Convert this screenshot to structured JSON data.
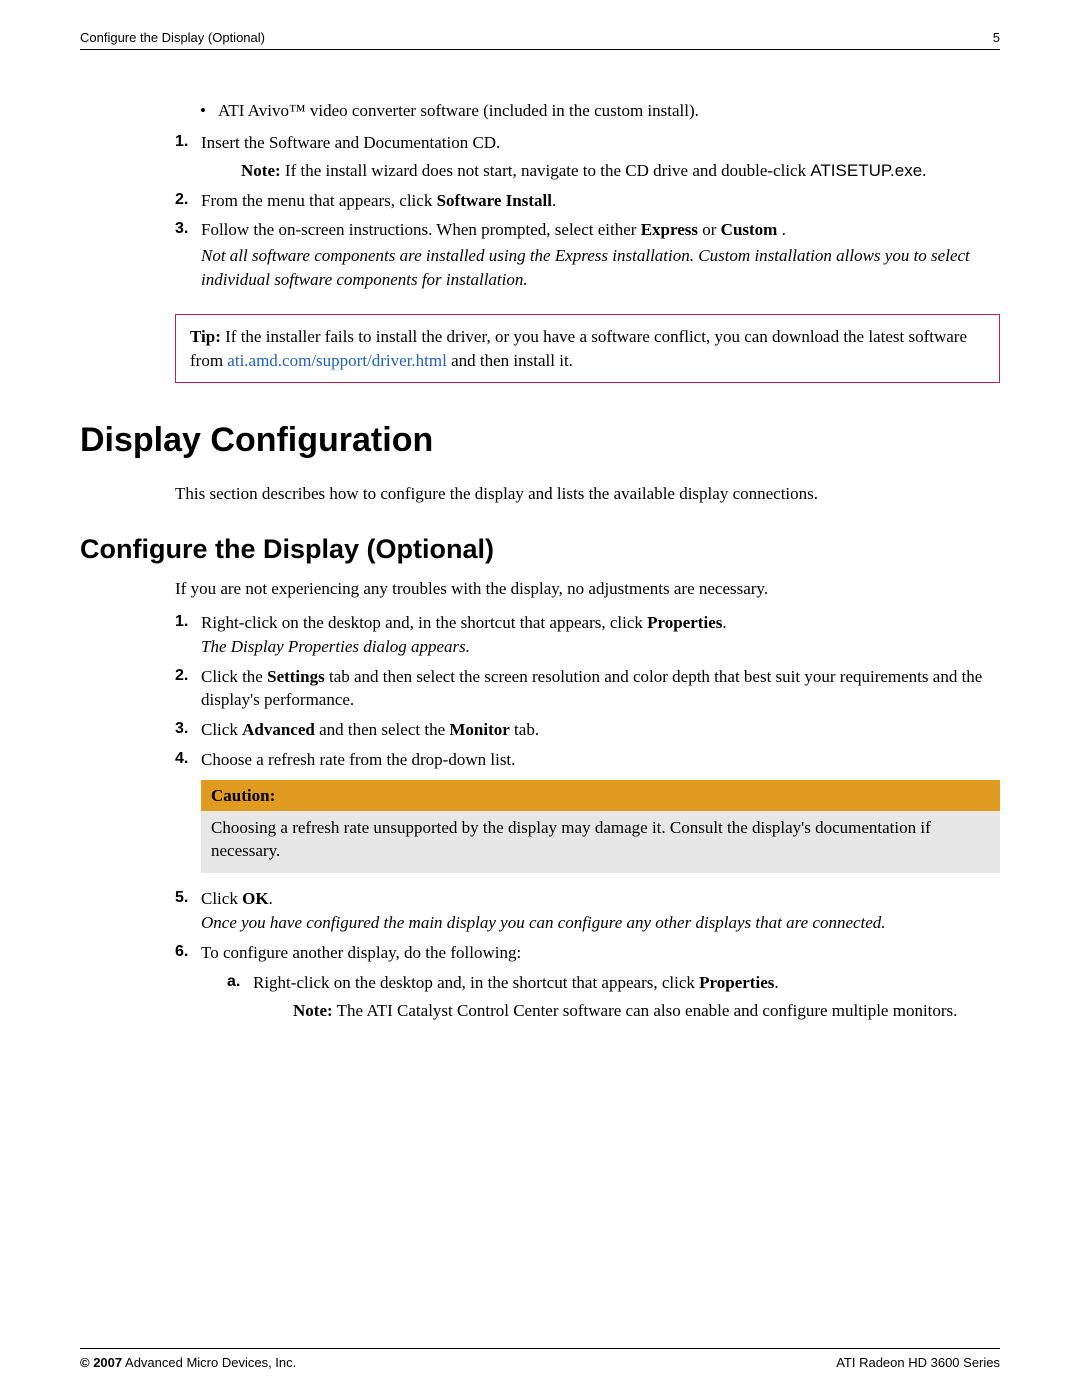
{
  "header": {
    "left": "Configure the Display (Optional)",
    "right": "5"
  },
  "bullet": {
    "text": "ATI Avivo™ video converter software (included in the custom install)."
  },
  "install_steps": {
    "s1": "Insert the Software and Documentation CD.",
    "s1_note_label": "Note:",
    "s1_note": "If the install wizard does not start, navigate to the CD drive and double-click ",
    "s1_note_file": "ATISETUP.exe",
    "s1_note_tail": ".",
    "s2_a": "From the menu that appears, click ",
    "s2_b": "Software Install",
    "s2_c": ".",
    "s3_a": "Follow the on-screen instructions. When prompted, select either ",
    "s3_b": "Express",
    "s3_c": " or ",
    "s3_d": "Custom",
    "s3_e": " .",
    "s3_note": "Not all software components are installed using the Express installation. Custom installation allows you to select individual software components for installation."
  },
  "tip": {
    "label": "Tip:",
    "t1": "If the installer fails to install the driver, or you have a software conflict, you can download the latest software from ",
    "link": "ati.amd.com/support/driver.html",
    "t2": " and then install it."
  },
  "h1": "Display Configuration",
  "h1_para": "This section describes how to configure the display and lists the available display connections.",
  "h2": "Configure the Display (Optional)",
  "h2_para": "If you are not experiencing any troubles with the display, no adjustments are necessary.",
  "cfg": {
    "s1_a": "Right-click on the desktop and, in the shortcut that appears, click ",
    "s1_b": "Properties",
    "s1_c": ".",
    "s1_note": "The Display Properties dialog appears.",
    "s2_a": "Click the ",
    "s2_b": "Settings",
    "s2_c": " tab and then select the screen resolution and color depth that best suit your requirements and the display's performance.",
    "s3_a": "Click ",
    "s3_b": "Advanced",
    "s3_c": " and then select the ",
    "s3_d": "Monitor",
    "s3_e": " tab.",
    "s4": "Choose a refresh rate from the drop-down list.",
    "caution_label": "Caution:",
    "caution_body": "Choosing a refresh rate unsupported by the display may damage it. Consult the display's documentation if necessary.",
    "s5_a": "Click ",
    "s5_b": "OK",
    "s5_c": ".",
    "s5_note": "Once you have configured the main display you can configure any other displays that are connected.",
    "s6": "To configure another display, do the following:",
    "s6a_a": "Right-click on the desktop and, in the shortcut that appears, click ",
    "s6a_b": "Properties",
    "s6a_c": ".",
    "s6a_note_label": "Note:",
    "s6a_note": "The ATI Catalyst Control Center software can also enable and configure multiple monitors."
  },
  "footer": {
    "left_bold": "© 2007",
    "left_rest": " Advanced Micro Devices, Inc.",
    "right": "ATI Radeon HD 3600 Series"
  },
  "markers": {
    "m1": "1.",
    "m2": "2.",
    "m3": "3.",
    "m4": "4.",
    "m5": "5.",
    "m6": "6.",
    "ma": "a.",
    "bullet": "•"
  }
}
